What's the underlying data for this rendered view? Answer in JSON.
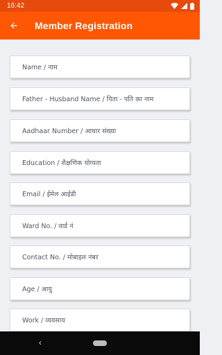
{
  "status": {
    "time": "16:42",
    "battery_icon": "battery-icon",
    "wifi_icon": "wifi-icon",
    "signal_icon": "signal-icon"
  },
  "appbar": {
    "title": "Member Registration",
    "back_icon": "arrow-back-icon",
    "background": "#ff5703"
  },
  "form": {
    "fields": [
      {
        "placeholder": "Name / नाम"
      },
      {
        "placeholder": "Father - Husband Name / पिता - पति का नाम"
      },
      {
        "placeholder": "Aadhaar Number / आधार संख्या"
      },
      {
        "placeholder": "Education / शैक्षणिक योग्यता"
      },
      {
        "placeholder": "Email / ईमेल आईडी"
      },
      {
        "placeholder": "Ward No. / वार्ड नं"
      },
      {
        "placeholder": "Contact No. / मोबाइल नंबर"
      },
      {
        "placeholder": "Age / आयु"
      },
      {
        "placeholder": "Work / व्यवसाय"
      }
    ]
  },
  "navbar": {
    "back_icon": "nav-back-icon",
    "home_icon": "home-pill-icon"
  }
}
